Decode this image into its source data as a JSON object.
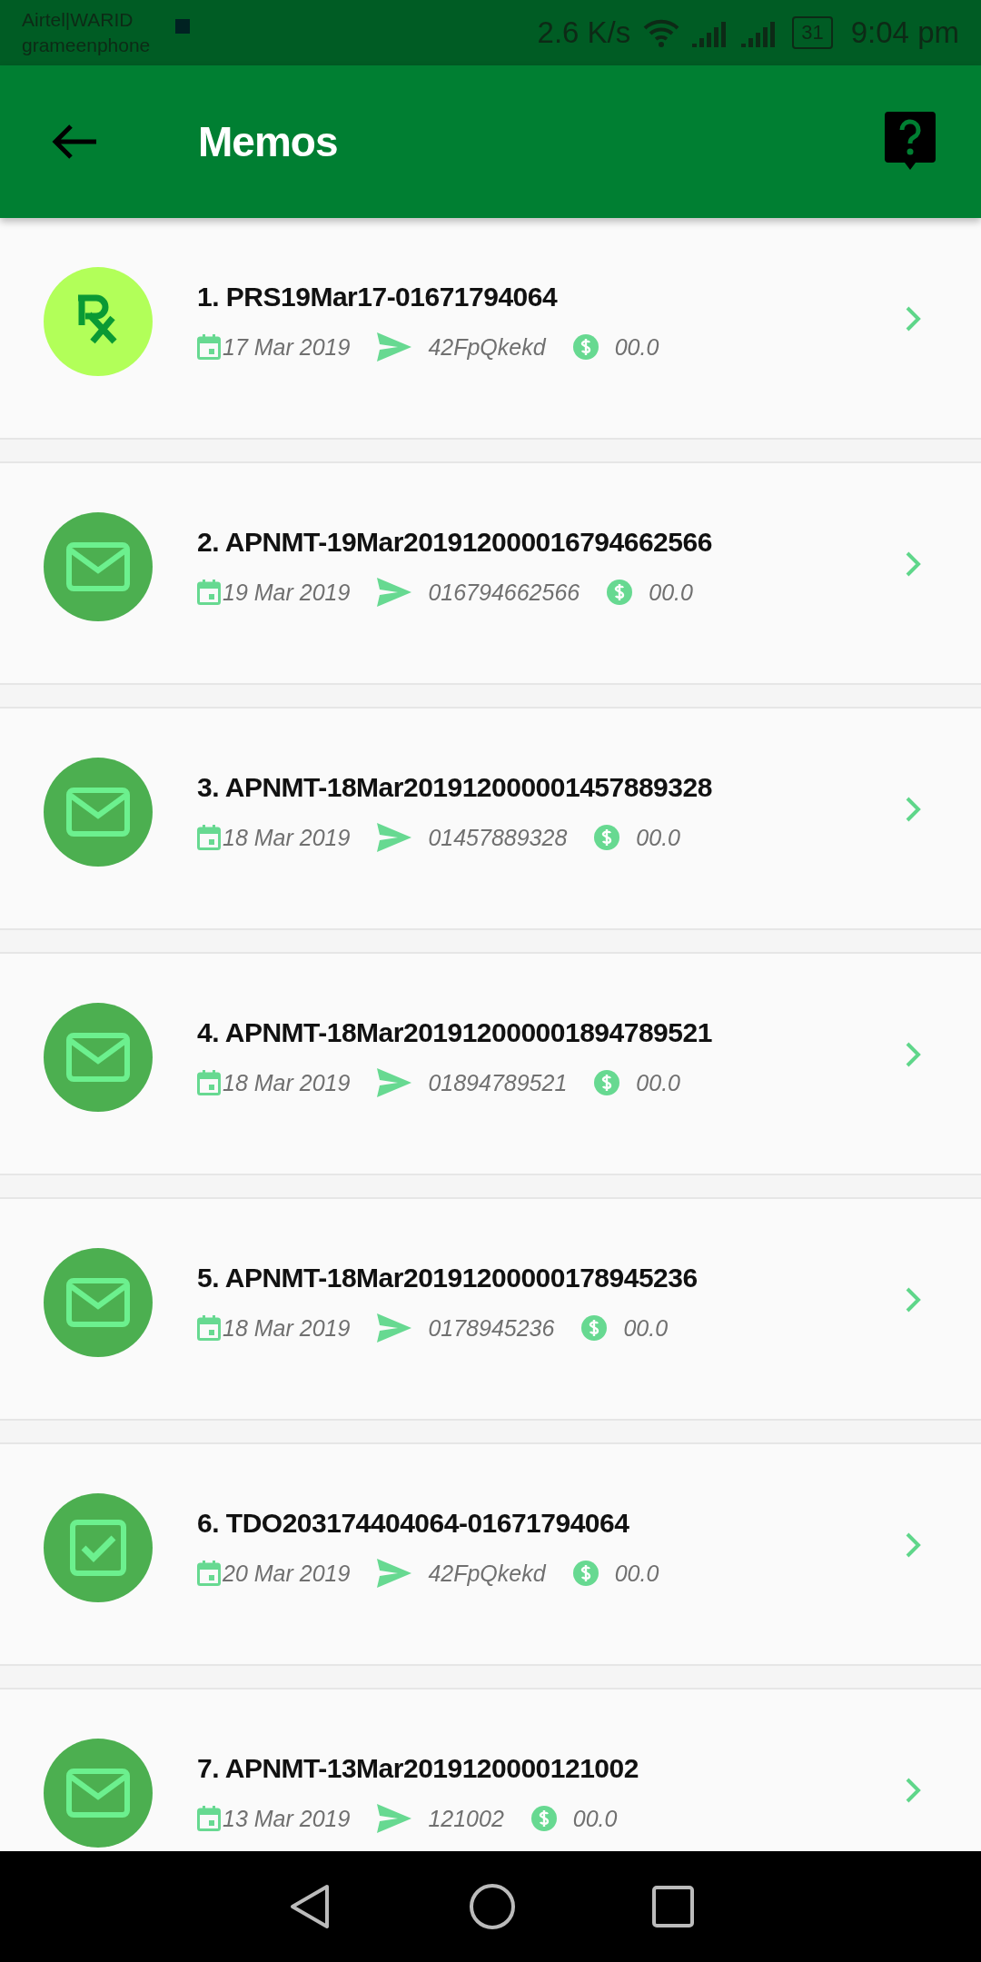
{
  "status_bar": {
    "carrier_1": "Airtel|WARID",
    "carrier_2": "grameenphone",
    "speed": "2.6 K/s",
    "battery": "31",
    "time": "9:04 pm"
  },
  "app_bar": {
    "title": "Memos"
  },
  "memos": [
    {
      "kind": "prescription",
      "title": "1. PRS19Mar17-01671794064",
      "date": "17 Mar 2019",
      "recipient": "42FpQkekd",
      "amount": "00.0"
    },
    {
      "kind": "message",
      "title": "2. APNMT-19Mar201912000016794662566",
      "date": "19 Mar 2019",
      "recipient": "016794662566",
      "amount": "00.0"
    },
    {
      "kind": "message",
      "title": "3. APNMT-18Mar201912000001457889328",
      "date": "18 Mar 2019",
      "recipient": "01457889328",
      "amount": "00.0"
    },
    {
      "kind": "message",
      "title": "4. APNMT-18Mar201912000001894789521",
      "date": "18 Mar 2019",
      "recipient": "01894789521",
      "amount": "00.0"
    },
    {
      "kind": "message",
      "title": "5. APNMT-18Mar20191200000178945236",
      "date": "18 Mar 2019",
      "recipient": "0178945236",
      "amount": "00.0"
    },
    {
      "kind": "task",
      "title": "6. TDO203174404064-01671794064",
      "date": "20 Mar 2019",
      "recipient": "42FpQkekd",
      "amount": "00.0"
    },
    {
      "kind": "message",
      "title": "7. APNMT-13Mar2019120000121002",
      "date": "13 Mar 2019",
      "recipient": "121002",
      "amount": "00.0"
    }
  ]
}
